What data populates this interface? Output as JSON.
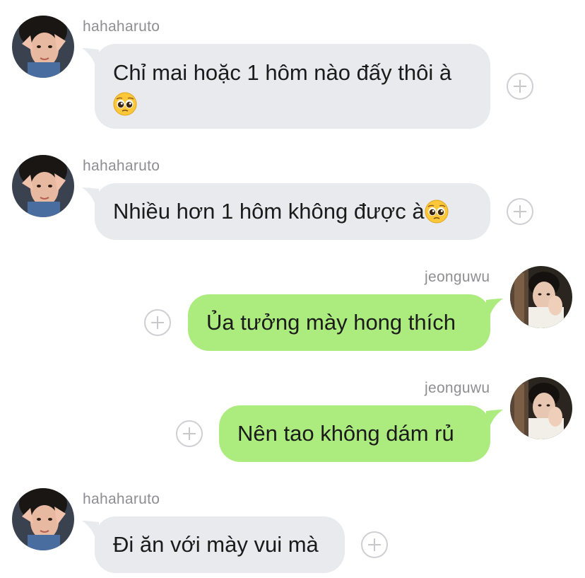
{
  "colors": {
    "incoming_bubble": "#e9eaee",
    "outgoing_bubble": "#acec7f",
    "sender_name": "#8e8e93",
    "react_button": "#c7c7cc"
  },
  "messages": [
    {
      "direction": "incoming",
      "sender": "hahaharuto",
      "line1": "Chỉ mai hoặc 1 hôm nào đấy thôi à",
      "emoji": "pleading-face-emoji"
    },
    {
      "direction": "incoming",
      "sender": "hahaharuto",
      "text": "Nhiều hơn 1 hôm không được à",
      "emoji": "pleading-face-emoji"
    },
    {
      "direction": "outgoing",
      "sender": "jeonguwu",
      "text": "Ủa tưởng mày hong thích"
    },
    {
      "direction": "outgoing",
      "sender": "jeonguwu",
      "text": "Nên tao không dám rủ"
    },
    {
      "direction": "incoming",
      "sender": "hahaharuto",
      "text": "Đi ăn với mày vui mà"
    }
  ],
  "icons": {
    "react": "add-reaction-icon",
    "avatar_incoming": "avatar-hahaharuto",
    "avatar_outgoing": "avatar-jeonguwu"
  }
}
